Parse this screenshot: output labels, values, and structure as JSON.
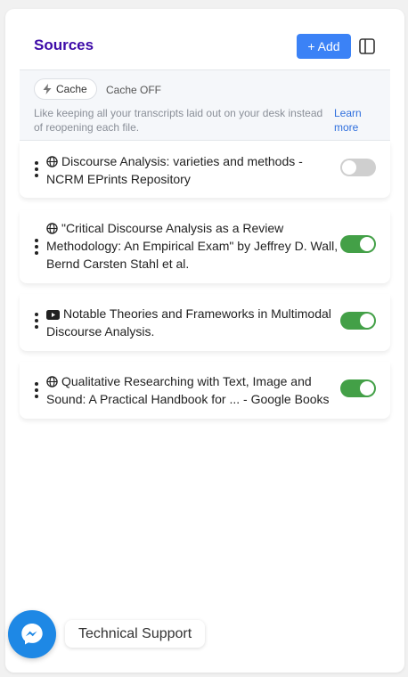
{
  "panel": {
    "title": "Sources",
    "add_label": "+ Add"
  },
  "cache": {
    "pill_label": "Cache",
    "status": "Cache OFF",
    "description": "Like keeping all your transcripts laid out on your desk instead of reopening each file.",
    "learn_more": "Learn more"
  },
  "sources": [
    {
      "icon": "globe-icon",
      "title": "Discourse Analysis: varieties and methods - NCRM EPrints Repository",
      "enabled": false
    },
    {
      "icon": "globe-icon",
      "title": "\"Critical Discourse Analysis as a Review Methodology: An Empirical Exam\" by Jeffrey D. Wall, Bernd Carsten Stahl et al.",
      "enabled": true
    },
    {
      "icon": "youtube-icon",
      "title": "Notable Theories and Frameworks in Multimodal Discourse Analysis.",
      "enabled": true
    },
    {
      "icon": "globe-icon",
      "title": "Qualitative Researching with Text, Image and Sound: A Practical Handbook for ... - Google Books",
      "enabled": true
    }
  ],
  "support": {
    "label": "Technical Support"
  },
  "colors": {
    "title": "#3d0aa8",
    "accent": "#3b82f6",
    "toggle_on": "#43a047",
    "toggle_off": "#cfcfcf",
    "link": "#2f6fdd",
    "messenger": "#1e88e5"
  }
}
